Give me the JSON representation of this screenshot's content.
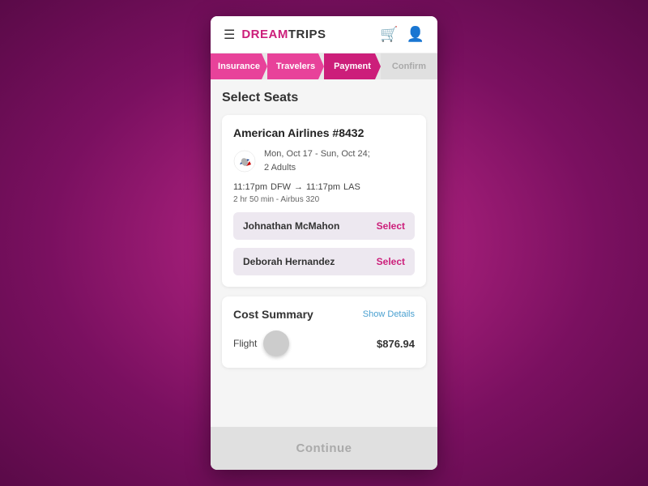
{
  "header": {
    "brand_dream": "DREAM",
    "brand_trips": "TRIPS"
  },
  "tabs": [
    {
      "label": "Insurance",
      "state": "completed"
    },
    {
      "label": "Travelers",
      "state": "completed"
    },
    {
      "label": "Payment",
      "state": "active"
    },
    {
      "label": "Confirm",
      "state": "inactive"
    }
  ],
  "section": {
    "title": "Select Seats"
  },
  "flight": {
    "number": "American Airlines #8432",
    "dates": "Mon, Oct 17 - Sun, Oct 24;",
    "adults": "2 Adults",
    "departure_time": "11:17pm",
    "departure_airport": "DFW",
    "arrival_time": "11:17pm",
    "arrival_airport": "LAS",
    "duration": "2 hr 50 min - Airbus 320"
  },
  "passengers": [
    {
      "name": "Johnathan McMahon",
      "select_label": "Select"
    },
    {
      "name": "Deborah Hernandez",
      "select_label": "Select"
    }
  ],
  "cost_summary": {
    "title": "Cost Summary",
    "show_details_label": "Show Details",
    "flight_label": "Flight",
    "flight_amount": "$876.94"
  },
  "continue_button": {
    "label": "Continue"
  }
}
